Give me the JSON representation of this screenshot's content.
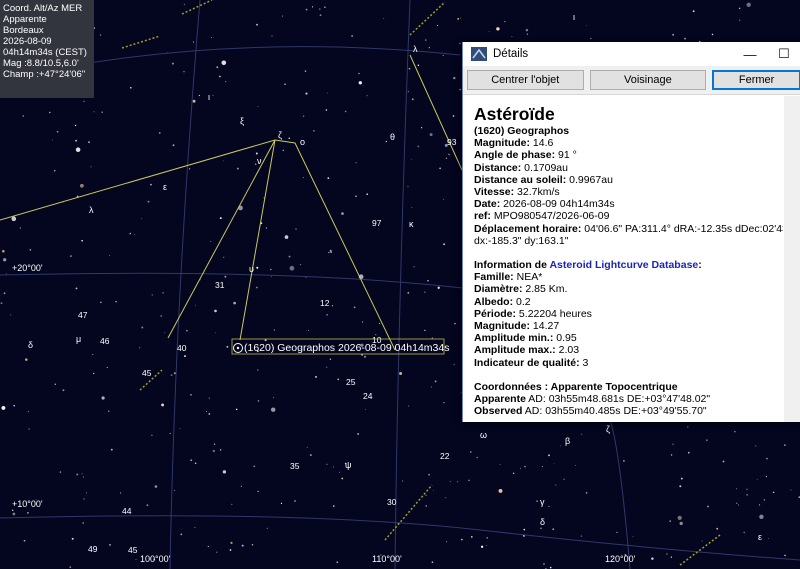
{
  "info": {
    "lines": [
      "Coord. Alt/Az MER",
      "Apparente",
      "Bordeaux",
      "2026-08-09",
      "04h14m34s (CEST)",
      "Mag :8.8/10.5,6.0'",
      "Champ :+47°24'06\""
    ]
  },
  "chart": {
    "grid_labels": [
      "+20°00'",
      "+10°00'",
      "100°00'",
      "110°00'",
      "120°00'"
    ],
    "star_numbers": [
      "31",
      "12",
      "47",
      "46",
      "40",
      "45",
      "25",
      "24",
      "35",
      "97",
      "93",
      "10",
      "22",
      "30",
      "44",
      "49",
      "45"
    ],
    "greek_letters": [
      "λ",
      "λ",
      "ζ",
      "ο",
      "ι",
      "ε",
      "ξ",
      "ν",
      "θ",
      "κ",
      "μ",
      "υ",
      "δ",
      "ζ",
      "ι",
      "γ",
      "δ",
      "ψ",
      "β",
      "ω",
      "ε"
    ],
    "asteroid_label": "(1620) Geographos 2026-08-09 04h14m34s",
    "colors": {
      "sky": "#04051f",
      "grid": "#30386a",
      "constellation": "#c9c95a",
      "ecliptic": "#a0a020"
    }
  },
  "dialog": {
    "title": "Détails",
    "minimize": "—",
    "maximize": "☐",
    "buttons": {
      "center": "Centrer l'objet",
      "neighborhood": "Voisinage",
      "close": "Fermer"
    },
    "heading": "Astéroïde",
    "name": "(1620) Geographos",
    "fields": [
      {
        "label": "Magnitude:",
        "value": " 14.6"
      },
      {
        "label": "Angle de phase:",
        "value": " 91 °"
      },
      {
        "label": "Distance:",
        "value": " 0.1709au"
      },
      {
        "label": "Distance au soleil:",
        "value": " 0.9967au"
      },
      {
        "label": "Vitesse:",
        "value": " 32.7km/s"
      },
      {
        "label": "Date:",
        "value": " 2026-08-09 04h14m34s"
      },
      {
        "label": "ref:",
        "value": " MPO980547/2026-06-09"
      },
      {
        "label": "Déplacement horaire:",
        "value": " 04'06.6\" PA:311.4° dRA:-12.35s dDec:02'43.1\""
      }
    ],
    "displacement_xy": "dx:-185.3\" dy:163.1\"",
    "lcdb": {
      "prefix": "Information de ",
      "link": "Asteroid Lightcurve Database",
      ",": "",
      "suffix": ":"
    },
    "lcdb_fields": [
      {
        "label": "Famille:",
        "value": " NEA*"
      },
      {
        "label": "Diamètre:",
        "value": " 2.85 Km."
      },
      {
        "label": "Albedo:",
        "value": " 0.2"
      },
      {
        "label": "Période:",
        "value": " 5.22204 heures"
      },
      {
        "label": "Magnitude:",
        "value": " 14.27"
      },
      {
        "label": "Amplitude min.:",
        "value": " 0.95"
      },
      {
        "label": "Amplitude max.:",
        "value": " 2.03"
      },
      {
        "label": "Indicateur de qualité:",
        "value": " 3"
      }
    ],
    "coords_title": "Coordonnées : Apparente Topocentrique",
    "coords": [
      {
        "label": "Apparente",
        "value": " AD: 03h55m48.681s DE:+03°47'48.02\""
      },
      {
        "label": "Observed",
        "value": " AD: 03h55m40.485s DE:+03°49'55.70\""
      }
    ]
  }
}
